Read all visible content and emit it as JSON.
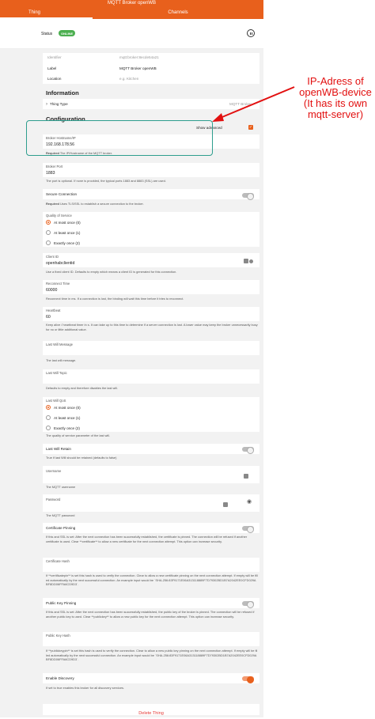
{
  "header": {
    "title": "MQTT Broker openWB"
  },
  "tabs": [
    {
      "label": "Thing"
    },
    {
      "label": "Channels"
    }
  ],
  "status": {
    "label": "Status",
    "badge": "ONLINE",
    "badge_color": "#4caf50"
  },
  "fields": {
    "identifier": {
      "label": "Identifier",
      "value": "mqtt:broker:8ecde54a21"
    },
    "label": {
      "label": "Label",
      "value": "MQTT Broker openWB"
    },
    "location": {
      "label": "Location",
      "placeholder": "e.g. Kitchen"
    }
  },
  "information": {
    "title": "Information",
    "thing_type_label": "Thing Type",
    "thing_type_value": "MQTT Broker"
  },
  "configuration": {
    "title": "Configuration",
    "show_advanced": "Show advanced"
  },
  "broker_host": {
    "label": "Broker Hostname/IP",
    "value": "192.168.178.56",
    "required": "Required",
    "help": "The IP/Hostname of the MQTT broker."
  },
  "broker_port": {
    "label": "Broker Port",
    "value": "1883",
    "help": "The port is optional. If none is provided, the typical ports 1883 and 8883 (SSL) are used."
  },
  "secure": {
    "label": "Secure Connection",
    "required": "Required",
    "help": "Uses TLS/SSL to establish a secure connection to the broker."
  },
  "qos": {
    "label": "Quality of Service",
    "options": [
      "At most once (0)",
      "At least once (1)",
      "Exactly once (2)"
    ],
    "selected": 0
  },
  "client_id": {
    "label": "Client ID",
    "value": "openhabclientid",
    "help": "Use a fixed client ID. Defaults to empty which means a client ID is generated for this connection."
  },
  "reconnect": {
    "label": "Reconnect Time",
    "value": "60000",
    "help": "Reconnect time in ms. If a connection is lost, the binding will wait this time before it tries to reconnect."
  },
  "heartbeat": {
    "label": "Heartbeat",
    "value": "60",
    "help": "Keep alive / heartbeat timer in s. It can take up to this time to determine if a server connection is lost. A lower value may keep the broker unnecessarily busy for no or little additional value."
  },
  "lwt_message": {
    "label": "Last Will Message",
    "help": "The last will message."
  },
  "lwt_topic": {
    "label": "Last Will Topic",
    "help": "Defaults to empty and therefore disables the last will."
  },
  "lwt_qos": {
    "label": "Last Will QoS",
    "options": [
      "At most once (0)",
      "At least once (1)",
      "Exactly once (2)"
    ],
    "selected": 0,
    "help": "The quality of service parameter of the last will."
  },
  "lwt_retain": {
    "label": "Last Will Retain",
    "help": "True if last Will should be retained (defaults to false)"
  },
  "username": {
    "label": "Username",
    "help": "The MQTT username"
  },
  "password": {
    "label": "Password",
    "help": "The MQTT password"
  },
  "cert_pin": {
    "label": "Certificate Pinning",
    "help": "If this and SSL is set: After the next connection has been successfully established, the certificate is pinned. The connection will be refused if another certificate is used. Clear **certificate** to allow a new certificate for the next connection attempt. This option can increase security."
  },
  "cert_hash": {
    "label": "Certificate Hash",
    "help": "If **certificatepin** is set this hash is used to verify the connection. Clear to allow a new certificate pinning on the next connection attempt. If empty will be filled automatically by the next successful connection. An example input would be `SHA-256:83F9171E06A313118889F7D79302BD1B7A2042EE0CFD029ABF8DD06FFA6CD9D3`."
  },
  "pubkey_pin": {
    "label": "Public Key Pinning",
    "help": "If this and SSL is set: After the next connection has been successfully established, the public key of the broker is pinned. The connection will be refused if another public key is used. Clear **publickey** to allow a new public key for the next connection attempt. This option can increase security."
  },
  "pubkey_hash": {
    "label": "Public Key Hash",
    "help": "If **publickeypin** is set this hash is used to verify the connection. Clear to allow a new public key pinning on the next connection attempt. If empty will be filled automatically by the next successful connection. An example input would be `SHA-256:83F9171E06A313118889F7D79302BD1B7A2042EE0CFD029ABF8DD06FFA6CD9D3`."
  },
  "discovery": {
    "label": "Enable Discovery",
    "help": "If set to true enables this broker for all discovery services."
  },
  "delete": {
    "label": "Delete Thing"
  },
  "annotation": {
    "text": "IP-Adress of openWB-device (It has its own mqtt-server)"
  },
  "colors": {
    "accent": "#e8601c",
    "annotation": "#e21010",
    "highlight": "#2e9e8e"
  }
}
